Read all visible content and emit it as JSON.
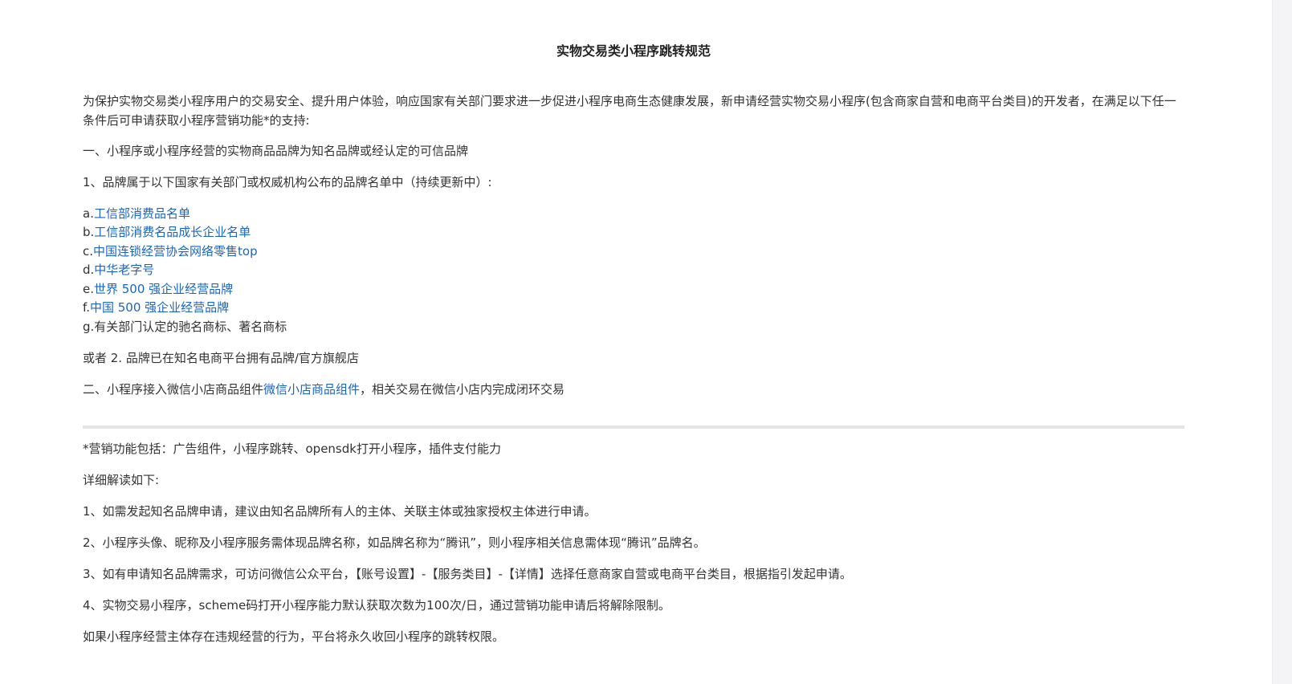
{
  "document": {
    "title": "实物交易类小程序跳转规范",
    "intro": "为保护实物交易类小程序用户的交易安全、提升用户体验，响应国家有关部门要求进一步促进小程序电商生态健康发展，新申请经营实物交易小程序(包含商家自营和电商平台类目)的开发者，在满足以下任一条件后可申请获取小程序营销功能*的支持:",
    "section1_heading": "一、小程序或小程序经营的实物商品品牌为知名品牌或经认定的可信品牌",
    "section1_item1": "1、品牌属于以下国家有关部门或权威机构公布的品牌名单中（持续更新中）:",
    "brand_lists": [
      {
        "prefix": "a.",
        "link": "工信部消费品名单"
      },
      {
        "prefix": "b.",
        "link": "工信部消费名品成长企业名单"
      },
      {
        "prefix": "c.",
        "link": "中国连锁经营协会网络零售top"
      },
      {
        "prefix": "d.",
        "link": "中华老字号"
      },
      {
        "prefix": "e.",
        "link": "世界 500 强企业经营品牌"
      },
      {
        "prefix": "f.",
        "link": "中国 500 强企业经营品牌"
      }
    ],
    "brand_item_g": "g.有关部门认定的驰名商标、著名商标",
    "section1_item2": "或者 2. 品牌已在知名电商平台拥有品牌/官方旗舰店",
    "section2_before": "二、小程序接入微信小店商品组件",
    "section2_link": "微信小店商品组件",
    "section2_after": "，相关交易在微信小店内完成闭环交易",
    "marketing_note": "*营销功能包括：广告组件，小程序跳转、opensdk打开小程序，插件支付能力",
    "details_heading": "详细解读如下:",
    "details": [
      "1、如需发起知名品牌申请，建议由知名品牌所有人的主体、关联主体或独家授权主体进行申请。",
      "2、小程序头像、昵称及小程序服务需体现品牌名称，如品牌名称为“腾讯”，则小程序相关信息需体现“腾讯”品牌名。",
      "3、如有申请知名品牌需求，可访问微信公众平台，【账号设置】-【服务类目】-【详情】选择任意商家自营或电商平台类目，根据指引发起申请。",
      "4、实物交易小程序，scheme码打开小程序能力默认获取次数为100次/日，通过营销功能申请后将解除限制。"
    ],
    "closing": "如果小程序经营主体存在违规经营的行为，平台将永久收回小程序的跳转权限。"
  },
  "colors": {
    "text": "#333333",
    "link": "#1a65c4",
    "divider": "#e4e4e8"
  }
}
